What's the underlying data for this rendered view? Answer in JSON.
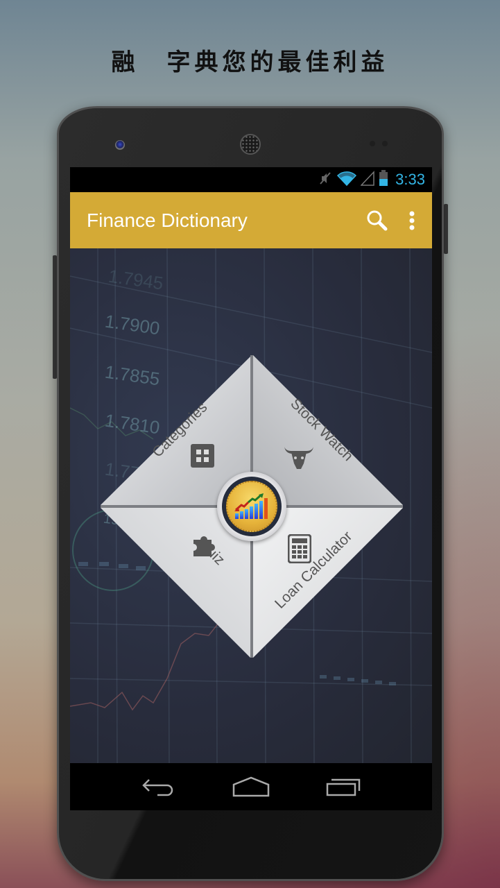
{
  "promo": {
    "headline": "融　字典您的最佳利益"
  },
  "statusbar": {
    "icons": [
      "mute-icon",
      "wifi-icon",
      "signal-icon",
      "battery-icon"
    ],
    "time": "3:33",
    "accent": "#33b5e5"
  },
  "appbar": {
    "title": "Finance Dictionary",
    "color": "#d4aa36",
    "actions": [
      {
        "name": "search",
        "icon": "search-icon"
      },
      {
        "name": "overflow-menu",
        "icon": "more-vert-icon"
      }
    ]
  },
  "background": {
    "chart_numbers": [
      "1.7945",
      "1.7900",
      "1.7855",
      "1.7810",
      "1.7765",
      "19"
    ]
  },
  "menu": {
    "items": [
      {
        "label": "Categories",
        "icon": "grid-icon"
      },
      {
        "label": "Stock Watch",
        "icon": "bull-icon"
      },
      {
        "label": "Quiz",
        "icon": "puzzle-icon"
      },
      {
        "label": "Loan Calculator",
        "icon": "calculator-icon"
      }
    ],
    "center_icon": "finance-chart-coin-icon"
  },
  "navbar": {
    "buttons": [
      {
        "name": "back",
        "icon": "back-icon"
      },
      {
        "name": "home",
        "icon": "home-icon"
      },
      {
        "name": "recents",
        "icon": "recents-icon"
      }
    ]
  }
}
